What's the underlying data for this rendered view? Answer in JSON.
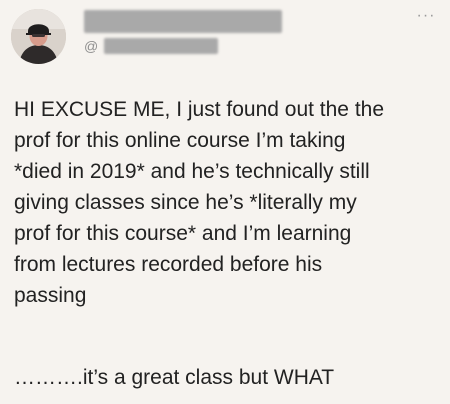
{
  "tweet": {
    "handle_prefix": "@",
    "more_label": "···",
    "lines": [
      "HI EXCUSE ME, I just found out the the",
      "prof for this online course I’m taking",
      "*died in 2019* and he’s technically still",
      "giving classes since he’s *literally my",
      "prof for this course* and I’m learning",
      "from lectures recorded before his",
      "passing"
    ],
    "closing": "……….it’s a great class but WHAT"
  },
  "colors": {
    "background": "#f6f3ef",
    "text": "#222222",
    "muted": "#8f8f8f",
    "redaction": "#a9a9a9"
  }
}
